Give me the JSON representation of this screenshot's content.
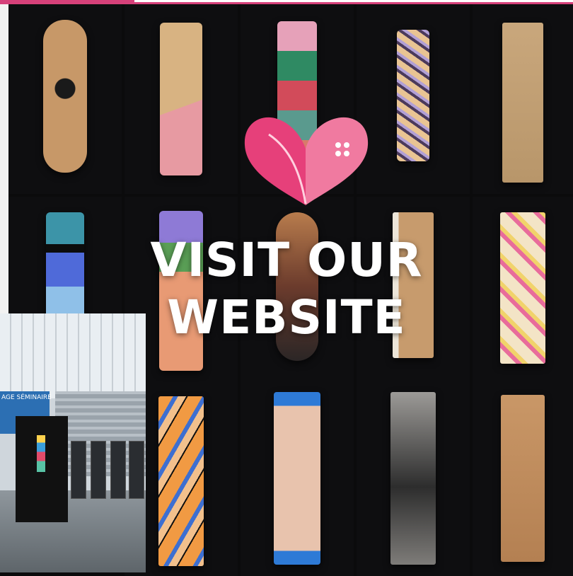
{
  "promo": {
    "cta_line1": "VISIT OUR",
    "cta_line2": "WEBSITE",
    "hall_sign": "AGE SÉMINAIRE"
  },
  "colors": {
    "accent": "#d6417a",
    "logo_left": "#e6407a",
    "logo_right": "#f08aa8",
    "text": "#ffffff"
  },
  "icons": [
    "heart-logo-icon"
  ]
}
